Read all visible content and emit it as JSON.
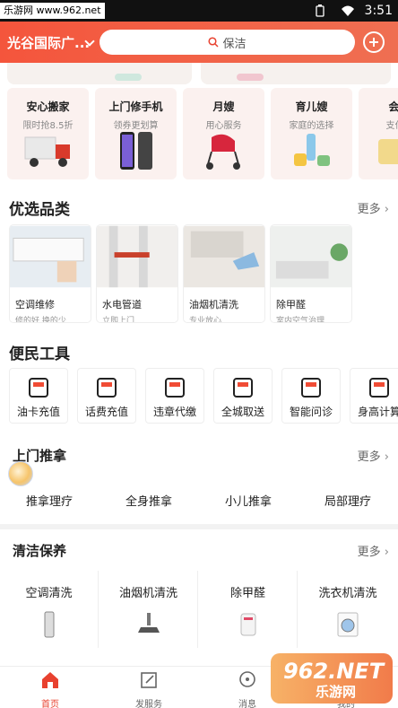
{
  "status_bar": {
    "site_label": "乐游网 www.962.net",
    "time": "3:51"
  },
  "header": {
    "location": "光谷国际广...",
    "search_placeholder": "保洁"
  },
  "services": [
    {
      "title": "安心搬家",
      "subtitle": "限时抢8.5折",
      "icon": "truck-icon"
    },
    {
      "title": "上门修手机",
      "subtitle": "领券更划算",
      "icon": "phone-icon"
    },
    {
      "title": "月嫂",
      "subtitle": "用心服务",
      "icon": "stroller-icon"
    },
    {
      "title": "育儿嫂",
      "subtitle": "家庭的选择",
      "icon": "baby-bottle-icon"
    },
    {
      "title": "会员",
      "subtitle": "支付最",
      "icon": "card-icon"
    }
  ],
  "featured": {
    "title": "优选品类",
    "more": "更多",
    "items": [
      {
        "title": "空调维修",
        "subtitle": "修的好 换的少"
      },
      {
        "title": "水电管道",
        "subtitle": "立即上门"
      },
      {
        "title": "油烟机清洗",
        "subtitle": "专业放心"
      },
      {
        "title": "除甲醛",
        "subtitle": "室内空气治理"
      }
    ]
  },
  "tools": {
    "title": "便民工具",
    "items": [
      {
        "label": "油卡充值",
        "icon": "fuel-icon"
      },
      {
        "label": "话费充值",
        "icon": "phone-bill-icon"
      },
      {
        "label": "违章代缴",
        "icon": "warning-icon"
      },
      {
        "label": "全城取送",
        "icon": "package-icon"
      },
      {
        "label": "智能问诊",
        "icon": "chat-icon"
      },
      {
        "label": "身高计算",
        "icon": "calculator-icon"
      }
    ]
  },
  "massage": {
    "title": "上门推拿",
    "more": "更多",
    "tabs": [
      "推拿理疗",
      "全身推拿",
      "小儿推拿",
      "局部理疗"
    ]
  },
  "cleaning": {
    "title": "清洁保养",
    "more": "更多",
    "items": [
      {
        "title": "空调清洗",
        "icon": "air-conditioner-icon"
      },
      {
        "title": "油烟机清洗",
        "icon": "range-hood-icon"
      },
      {
        "title": "除甲醛",
        "icon": "air-purifier-icon"
      },
      {
        "title": "洗衣机清洗",
        "icon": "washing-machine-icon"
      }
    ]
  },
  "bottom_nav": [
    {
      "label": "首页",
      "icon": "home-icon",
      "active": true
    },
    {
      "label": "发服务",
      "icon": "edit-icon",
      "active": false
    },
    {
      "label": "消息",
      "icon": "message-icon",
      "active": false
    },
    {
      "label": "我的",
      "icon": "user-icon",
      "active": false
    }
  ],
  "watermark": {
    "brand": "962.NET",
    "cn": "乐游网"
  },
  "colors": {
    "accent": "#f4553c",
    "active_nav": "#e8412f"
  }
}
